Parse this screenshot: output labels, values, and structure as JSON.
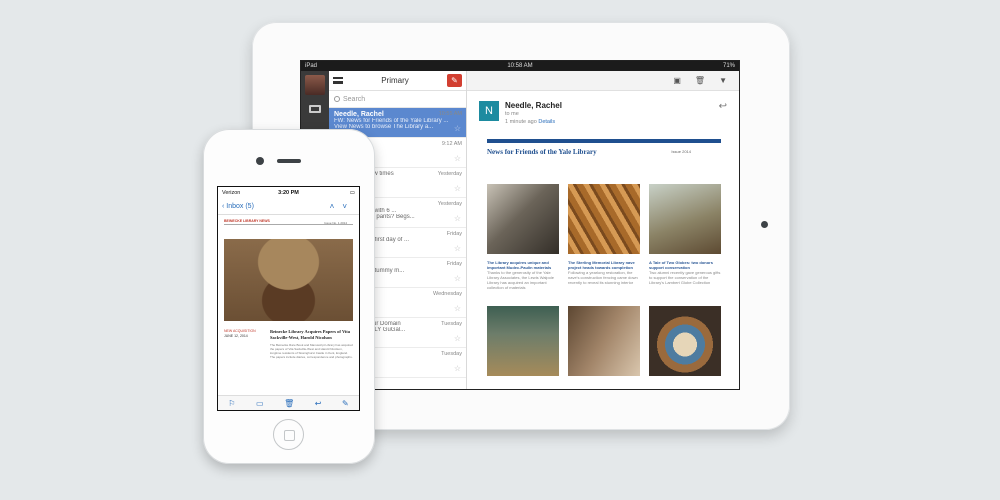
{
  "ipad": {
    "status": {
      "device": "iPad",
      "time": "10:58 AM",
      "battery": "71%"
    },
    "list_title": "Primary",
    "search_placeholder": "Search",
    "compose_icon": "pencil-icon",
    "mails": [
      {
        "from": "Needle, Rachel",
        "date": "10:55 AM",
        "line1": "FW: News for Friends of the Yale Library ...",
        "line2": "View News to browse The Library a...",
        "selected": true
      },
      {
        "from": "",
        "date": "9:12 AM",
        "line1": "",
        "line2": "",
        "selected": false
      },
      {
        "from": "",
        "date": "Yesterday",
        "line1": "hip you up a few times",
        "line2": "",
        "selected": false
      },
      {
        "from": "lo",
        "date": "Yesterday",
        "line1": "your wardrobe with 6 ...",
        "line2": "s on drawstring pants? Begs...",
        "selected": false
      },
      {
        "from": "",
        "date": "Friday",
        "line1": "mmendations",
        "line2": "beaver! Happy first day of ...",
        "selected": false
      },
      {
        "from": "Caa",
        "date": "Friday",
        "line1": "ew! Wee twine tummy m...",
        "line2": "",
        "selected": false
      },
      {
        "from": "lie",
        "date": "Wednesday",
        "line1": "",
        "line2": "",
        "selected": false
      },
      {
        "from": "",
        "date": "Tuesday",
        "line1": "a Reqading Your Domain",
        "line2": "EMINDERPPOLY GuGal...",
        "selected": false
      },
      {
        "from": "",
        "date": "Tuesday",
        "line1": "",
        "line2": "",
        "selected": false
      }
    ],
    "reader": {
      "sender_initial": "N",
      "sender": "Needle, Rachel",
      "to": "to me",
      "ago": "1 minute ago",
      "details": "Details",
      "newsletter_title": "News for Friends of the Yale Library",
      "issue": "Issue 2014",
      "captions": [
        {
          "title": "The Library acquires unique and important Mudec-Paulin materials",
          "body": "Thanks to the generosity of the Yale Library Associates, the Lewis Walpole Library has acquired an important collection of materials"
        },
        {
          "title": "The Sterling Memorial Library nave project heads towards completion",
          "body": "Following a yearlong restoration, the nave's construction fencing came down recently to reveal its stunning interior"
        },
        {
          "title": "A Tale of Two Globes: two donors support conservation",
          "body": "Two alumni recently gave generous gifts to support the conservation of the Library's Lambert Globe Collection"
        }
      ]
    }
  },
  "iphone": {
    "status": {
      "carrier": "Verizon",
      "time": "3:20 PM"
    },
    "back_label": "Inbox (5)",
    "newsletter_head": "BEINECKE LIBRARY NEWS",
    "issue": "Issue No. 1 2014",
    "left_label": "NEW ACQUISITION",
    "left_date": "JUNE 12, 2014",
    "story_title": "Beinecke Library Acquires Papers of Vita Sackville-West, Harold Nicolson",
    "story_text": "The Beinecke Rare Book and Manuscript Library has acquired the papers of Vita Sackville-West and Harold Nicolson, longtime residents of Sissinghurst Castle in Kent, England. The papers include diaries, correspondence and photographs."
  }
}
